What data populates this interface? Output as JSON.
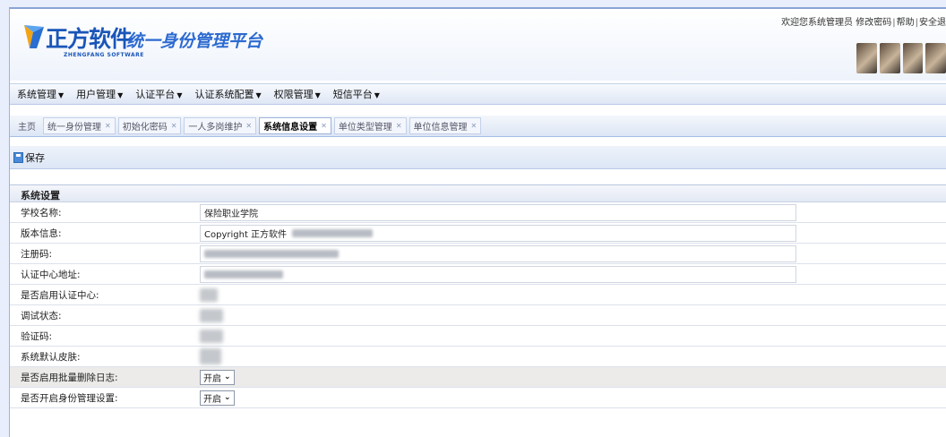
{
  "header": {
    "brand_name": "正方软件",
    "brand_sub": "ZHENGFANG SOFTWARE",
    "platform_title": "统一身份管理平台",
    "top_links": [
      "欢迎您系统管理员",
      "修改密码",
      "帮助",
      "安全退"
    ]
  },
  "menu": {
    "items": [
      "系统管理",
      "用户管理",
      "认证平台",
      "认证系统配置",
      "权限管理",
      "短信平台"
    ]
  },
  "tabs": [
    {
      "label": "主页"
    },
    {
      "label": "统一身份管理"
    },
    {
      "label": "初始化密码"
    },
    {
      "label": "一人多岗维护"
    },
    {
      "label": "系统信息设置"
    },
    {
      "label": "单位类型管理"
    },
    {
      "label": "单位信息管理"
    }
  ],
  "toolbar": {
    "save_label": "保存"
  },
  "form": {
    "section_title": "系统设置",
    "fields": {
      "school_name": {
        "label": "学校名称:",
        "value": "保险职业学院"
      },
      "copyright": {
        "label": "版本信息:",
        "value": "Copyright  正方软件"
      },
      "register_code": {
        "label": "注册码:"
      },
      "auth_center_addr": {
        "label": "认证中心地址:"
      },
      "enable_auth_center": {
        "label": "是否启用认证中心:"
      },
      "debug_state": {
        "label": "调试状态:"
      },
      "verify_code": {
        "label": "验证码:"
      },
      "default_skin": {
        "label": "系统默认皮肤:"
      },
      "batch_delete_log": {
        "label": "是否启用批量删除日志:",
        "selected": "开启"
      },
      "identity_settings": {
        "label": "是否开启身份管理设置:",
        "selected": "开启"
      }
    }
  }
}
